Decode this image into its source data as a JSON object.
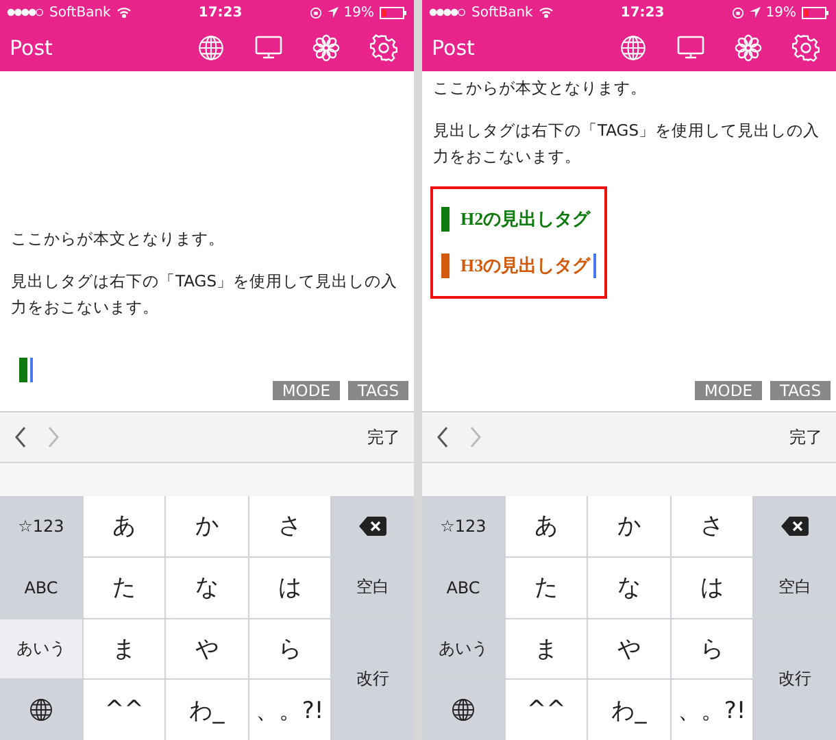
{
  "screens": [
    {
      "status_bar": {
        "carrier": "SoftBank",
        "time": "17:23",
        "battery": "19%"
      },
      "nav": {
        "title": "Post"
      },
      "scrolled": false,
      "editor": {
        "paragraphs": [
          "ここからが本文となります。",
          "見出しタグは右下の「TAGS」を使用して見出しの入力をおこないます。"
        ],
        "highlighted": false,
        "blocks": [
          {
            "kind": "heading",
            "color": "#0e7a0e",
            "cursor": true
          }
        ]
      },
      "tool_buttons": [
        "MODE",
        "TAGS"
      ],
      "toolbar": {
        "done": "完了"
      },
      "keyboard": [
        {
          "kind": "function",
          "label": "☆123",
          "selected": false
        },
        {
          "kind": "kana",
          "label": "あ"
        },
        {
          "kind": "kana",
          "label": "か"
        },
        {
          "kind": "kana",
          "label": "さ"
        },
        {
          "kind": "delete",
          "selected": false
        },
        {
          "kind": "function",
          "label": "ABC",
          "selected": false
        },
        {
          "kind": "kana",
          "label": "た"
        },
        {
          "kind": "kana",
          "label": "な"
        },
        {
          "kind": "kana",
          "label": "は"
        },
        {
          "kind": "function",
          "label": "空白",
          "selected": false
        },
        {
          "kind": "function",
          "label": "あいう",
          "selected": true
        },
        {
          "kind": "kana",
          "label": "ま"
        },
        {
          "kind": "kana",
          "label": "や"
        },
        {
          "kind": "kana",
          "label": "ら"
        },
        {
          "kind": "return",
          "label": "改行"
        },
        {
          "kind": "globe",
          "selected": false
        },
        {
          "kind": "kana",
          "label": "^^"
        },
        {
          "kind": "kana",
          "label": "わ_"
        },
        {
          "kind": "kana",
          "label": "、。?!"
        }
      ]
    },
    {
      "status_bar": {
        "carrier": "SoftBank",
        "time": "17:23",
        "battery": "19%"
      },
      "nav": {
        "title": "Post"
      },
      "scrolled": true,
      "editor": {
        "paragraphs": [
          "ここからが本文となります。",
          "見出しタグは右下の「TAGS」を使用して見出しの入力をおこないます。"
        ],
        "highlighted": true,
        "blocks": [
          {
            "kind": "heading",
            "color": "#0e7a0e",
            "label": "H2の見出しタグ",
            "cursor": false
          },
          {
            "kind": "heading",
            "color": "#d25a0a",
            "label": "H3の見出しタグ",
            "cursor": true
          }
        ]
      },
      "tool_buttons": [
        "MODE",
        "TAGS"
      ],
      "toolbar": {
        "done": "完了"
      },
      "keyboard": [
        {
          "kind": "function",
          "label": "☆123",
          "selected": false
        },
        {
          "kind": "kana",
          "label": "あ"
        },
        {
          "kind": "kana",
          "label": "か"
        },
        {
          "kind": "kana",
          "label": "さ"
        },
        {
          "kind": "delete",
          "selected": false
        },
        {
          "kind": "function",
          "label": "ABC",
          "selected": false
        },
        {
          "kind": "kana",
          "label": "た"
        },
        {
          "kind": "kana",
          "label": "な"
        },
        {
          "kind": "kana",
          "label": "は"
        },
        {
          "kind": "function",
          "label": "空白",
          "selected": false
        },
        {
          "kind": "function",
          "label": "あいう",
          "selected": false
        },
        {
          "kind": "kana",
          "label": "ま"
        },
        {
          "kind": "kana",
          "label": "や"
        },
        {
          "kind": "kana",
          "label": "ら"
        },
        {
          "kind": "return",
          "label": "改行"
        },
        {
          "kind": "globe",
          "selected": false
        },
        {
          "kind": "kana",
          "label": "^^"
        },
        {
          "kind": "kana",
          "label": "わ_"
        },
        {
          "kind": "kana",
          "label": "、。?!"
        }
      ]
    }
  ]
}
